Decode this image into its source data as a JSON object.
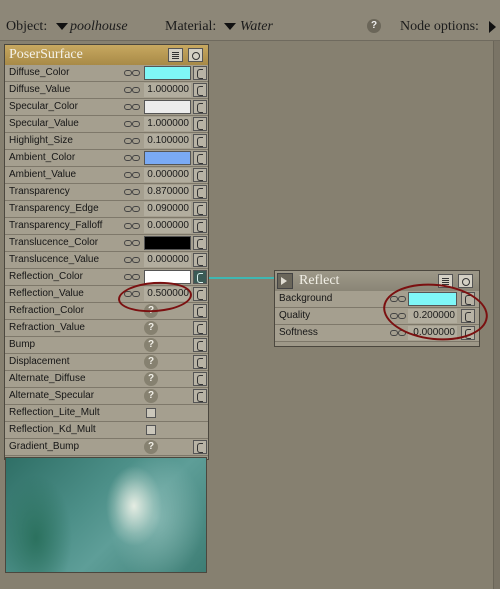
{
  "toolbar": {
    "object_label": "Object:",
    "object_value": "poolhouse",
    "material_label": "Material:",
    "material_value": "Water",
    "node_options_label": "Node options:"
  },
  "poser_surface": {
    "title": "PoserSurface",
    "rows": [
      {
        "label": "Diffuse_Color",
        "kind": "color",
        "color": "#7ff7f7"
      },
      {
        "label": "Diffuse_Value",
        "kind": "value",
        "value": "1.000000"
      },
      {
        "label": "Specular_Color",
        "kind": "color",
        "color": "#ececec"
      },
      {
        "label": "Specular_Value",
        "kind": "value",
        "value": "1.000000"
      },
      {
        "label": "Highlight_Size",
        "kind": "value",
        "value": "0.100000"
      },
      {
        "label": "Ambient_Color",
        "kind": "color",
        "color": "#7aaaf5"
      },
      {
        "label": "Ambient_Value",
        "kind": "value",
        "value": "0.000000"
      },
      {
        "label": "Transparency",
        "kind": "value",
        "value": "0.870000"
      },
      {
        "label": "Transparency_Edge",
        "kind": "value",
        "value": "0.090000"
      },
      {
        "label": "Transparency_Falloff",
        "kind": "value",
        "value": "0.000000"
      },
      {
        "label": "Translucence_Color",
        "kind": "color",
        "color": "#000000"
      },
      {
        "label": "Translucence_Value",
        "kind": "value",
        "value": "0.000000"
      },
      {
        "label": "Reflection_Color",
        "kind": "color",
        "color": "#ffffff",
        "connected": true
      },
      {
        "label": "Reflection_Value",
        "kind": "value",
        "value": "0.500000"
      },
      {
        "label": "Refraction_Color",
        "kind": "help"
      },
      {
        "label": "Refraction_Value",
        "kind": "help"
      },
      {
        "label": "Bump",
        "kind": "help"
      },
      {
        "label": "Displacement",
        "kind": "help"
      },
      {
        "label": "Alternate_Diffuse",
        "kind": "help"
      },
      {
        "label": "Alternate_Specular",
        "kind": "help"
      },
      {
        "label": "Reflection_Lite_Mult",
        "kind": "check"
      },
      {
        "label": "Reflection_Kd_Mult",
        "kind": "check"
      },
      {
        "label": "Gradient_Bump",
        "kind": "help"
      }
    ]
  },
  "reflect": {
    "title": "Reflect",
    "rows": [
      {
        "label": "Background",
        "kind": "color",
        "color": "#7ff7f7"
      },
      {
        "label": "Quality",
        "kind": "value",
        "value": "0.200000"
      },
      {
        "label": "Softness",
        "kind": "value",
        "value": "0.000000"
      }
    ]
  },
  "help_glyph": "?",
  "colors": {
    "connector": "#3fb7b2",
    "annotation_circles": "#7b1010",
    "poser_title": "#b8994f"
  }
}
